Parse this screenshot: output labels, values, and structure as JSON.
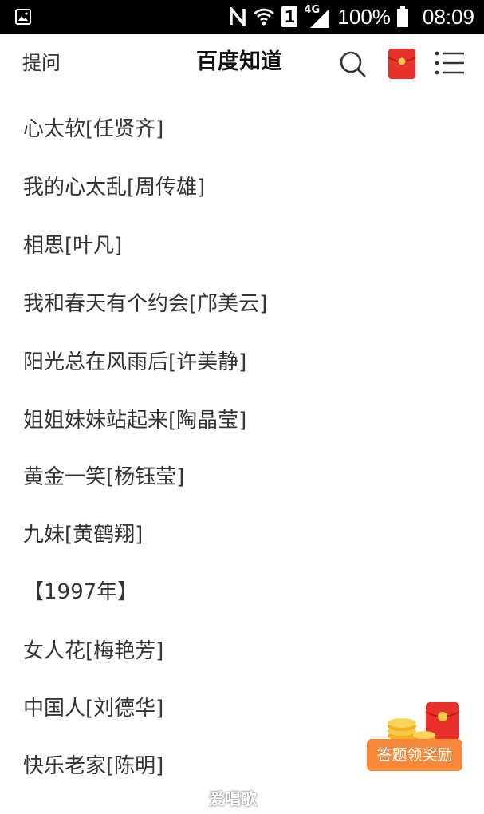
{
  "status_bar": {
    "sim_label": "1",
    "network_label": "4G",
    "battery_percent": "100%",
    "battery_level": 1.0,
    "time": "08:09",
    "icons": [
      "gallery-icon",
      "nfc-icon",
      "wifi-icon",
      "sim-icon",
      "signal-icon",
      "battery-icon"
    ]
  },
  "header": {
    "ask_label": "提问",
    "title": "百度知道",
    "icons": [
      "search-icon",
      "red-packet-icon",
      "menu-icon"
    ],
    "accent_color": "#e8312a"
  },
  "songs": [
    "心太软[任贤齐]",
    "我的心太乱[周传雄]",
    "相思[叶凡]",
    "我和春天有个约会[邝美云]",
    "阳光总在风雨后[许美静]",
    "姐姐妹妹站起来[陶晶莹]",
    "黄金一笑[杨钰莹]",
    "九妹[黄鹤翔]",
    "【1997年】",
    "女人花[梅艳芳]",
    "中国人[刘德华]",
    "快乐老家[陈明]"
  ],
  "reward": {
    "label": "答题领奖励",
    "color": "#f6883b"
  },
  "watermark": "爱唱歌"
}
